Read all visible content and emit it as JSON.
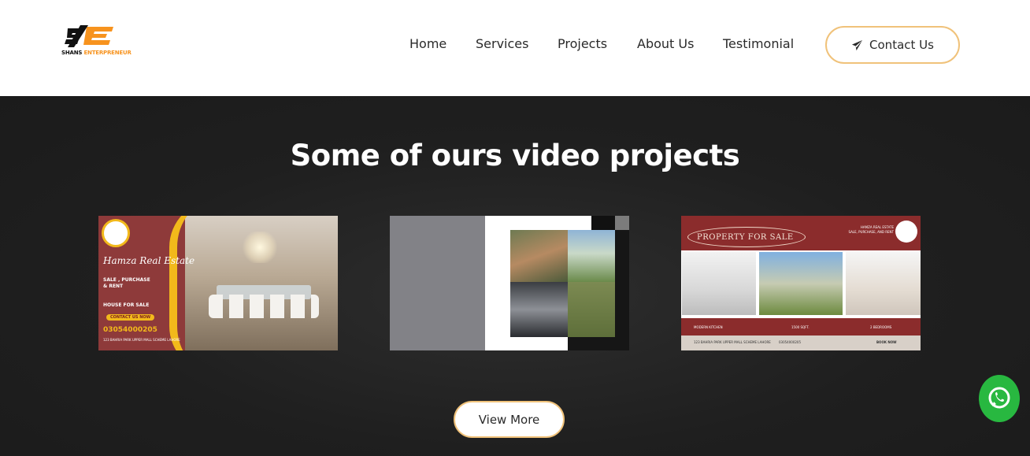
{
  "header": {
    "logo_brand_text": "SHANS ENTERPRENEUR",
    "logo_w1": "SHANS",
    "logo_w2": "ENTERPRENEUR",
    "nav": [
      "Home",
      "Services",
      "Projects",
      "About Us",
      "Testimonial"
    ],
    "contact_label": "Contact Us",
    "contact_icon": "paper-plane-icon"
  },
  "section": {
    "title": "Some of ours video projects",
    "view_more_label": "View More"
  },
  "cards": {
    "c1": {
      "title": "Hamza Real Estate",
      "line1": "SALE , PURCHASE",
      "line2": "& RENT",
      "house": "HOUSE FOR SALE",
      "contact": "CONTACT US NOW",
      "phone": "03054000205",
      "address": "123 BAHRIA PARK UPPER MALL SCHEME LAHORE"
    },
    "c3": {
      "heading": "PROPERTY FOR SALE",
      "brand1": "HAMZA REAL ESTATE",
      "brand2": "SALE, PURCHASE, AND RENT",
      "f1": "MODERN KITCHEN",
      "f2": "1500 SQFT.",
      "f3": "2 BEDROOMS",
      "addr": "123 BAHRIA PARK UPPER MALL SCHEME LAHORE",
      "phone": "03054000205",
      "book": "BOOK NOW"
    }
  },
  "colors": {
    "accent_border": "#f0c27a",
    "dark_bg": "#1c1c1c",
    "brand_orange": "#f7931e",
    "whatsapp_green": "#28b840"
  },
  "floating": {
    "whatsapp_icon": "whatsapp-icon"
  }
}
